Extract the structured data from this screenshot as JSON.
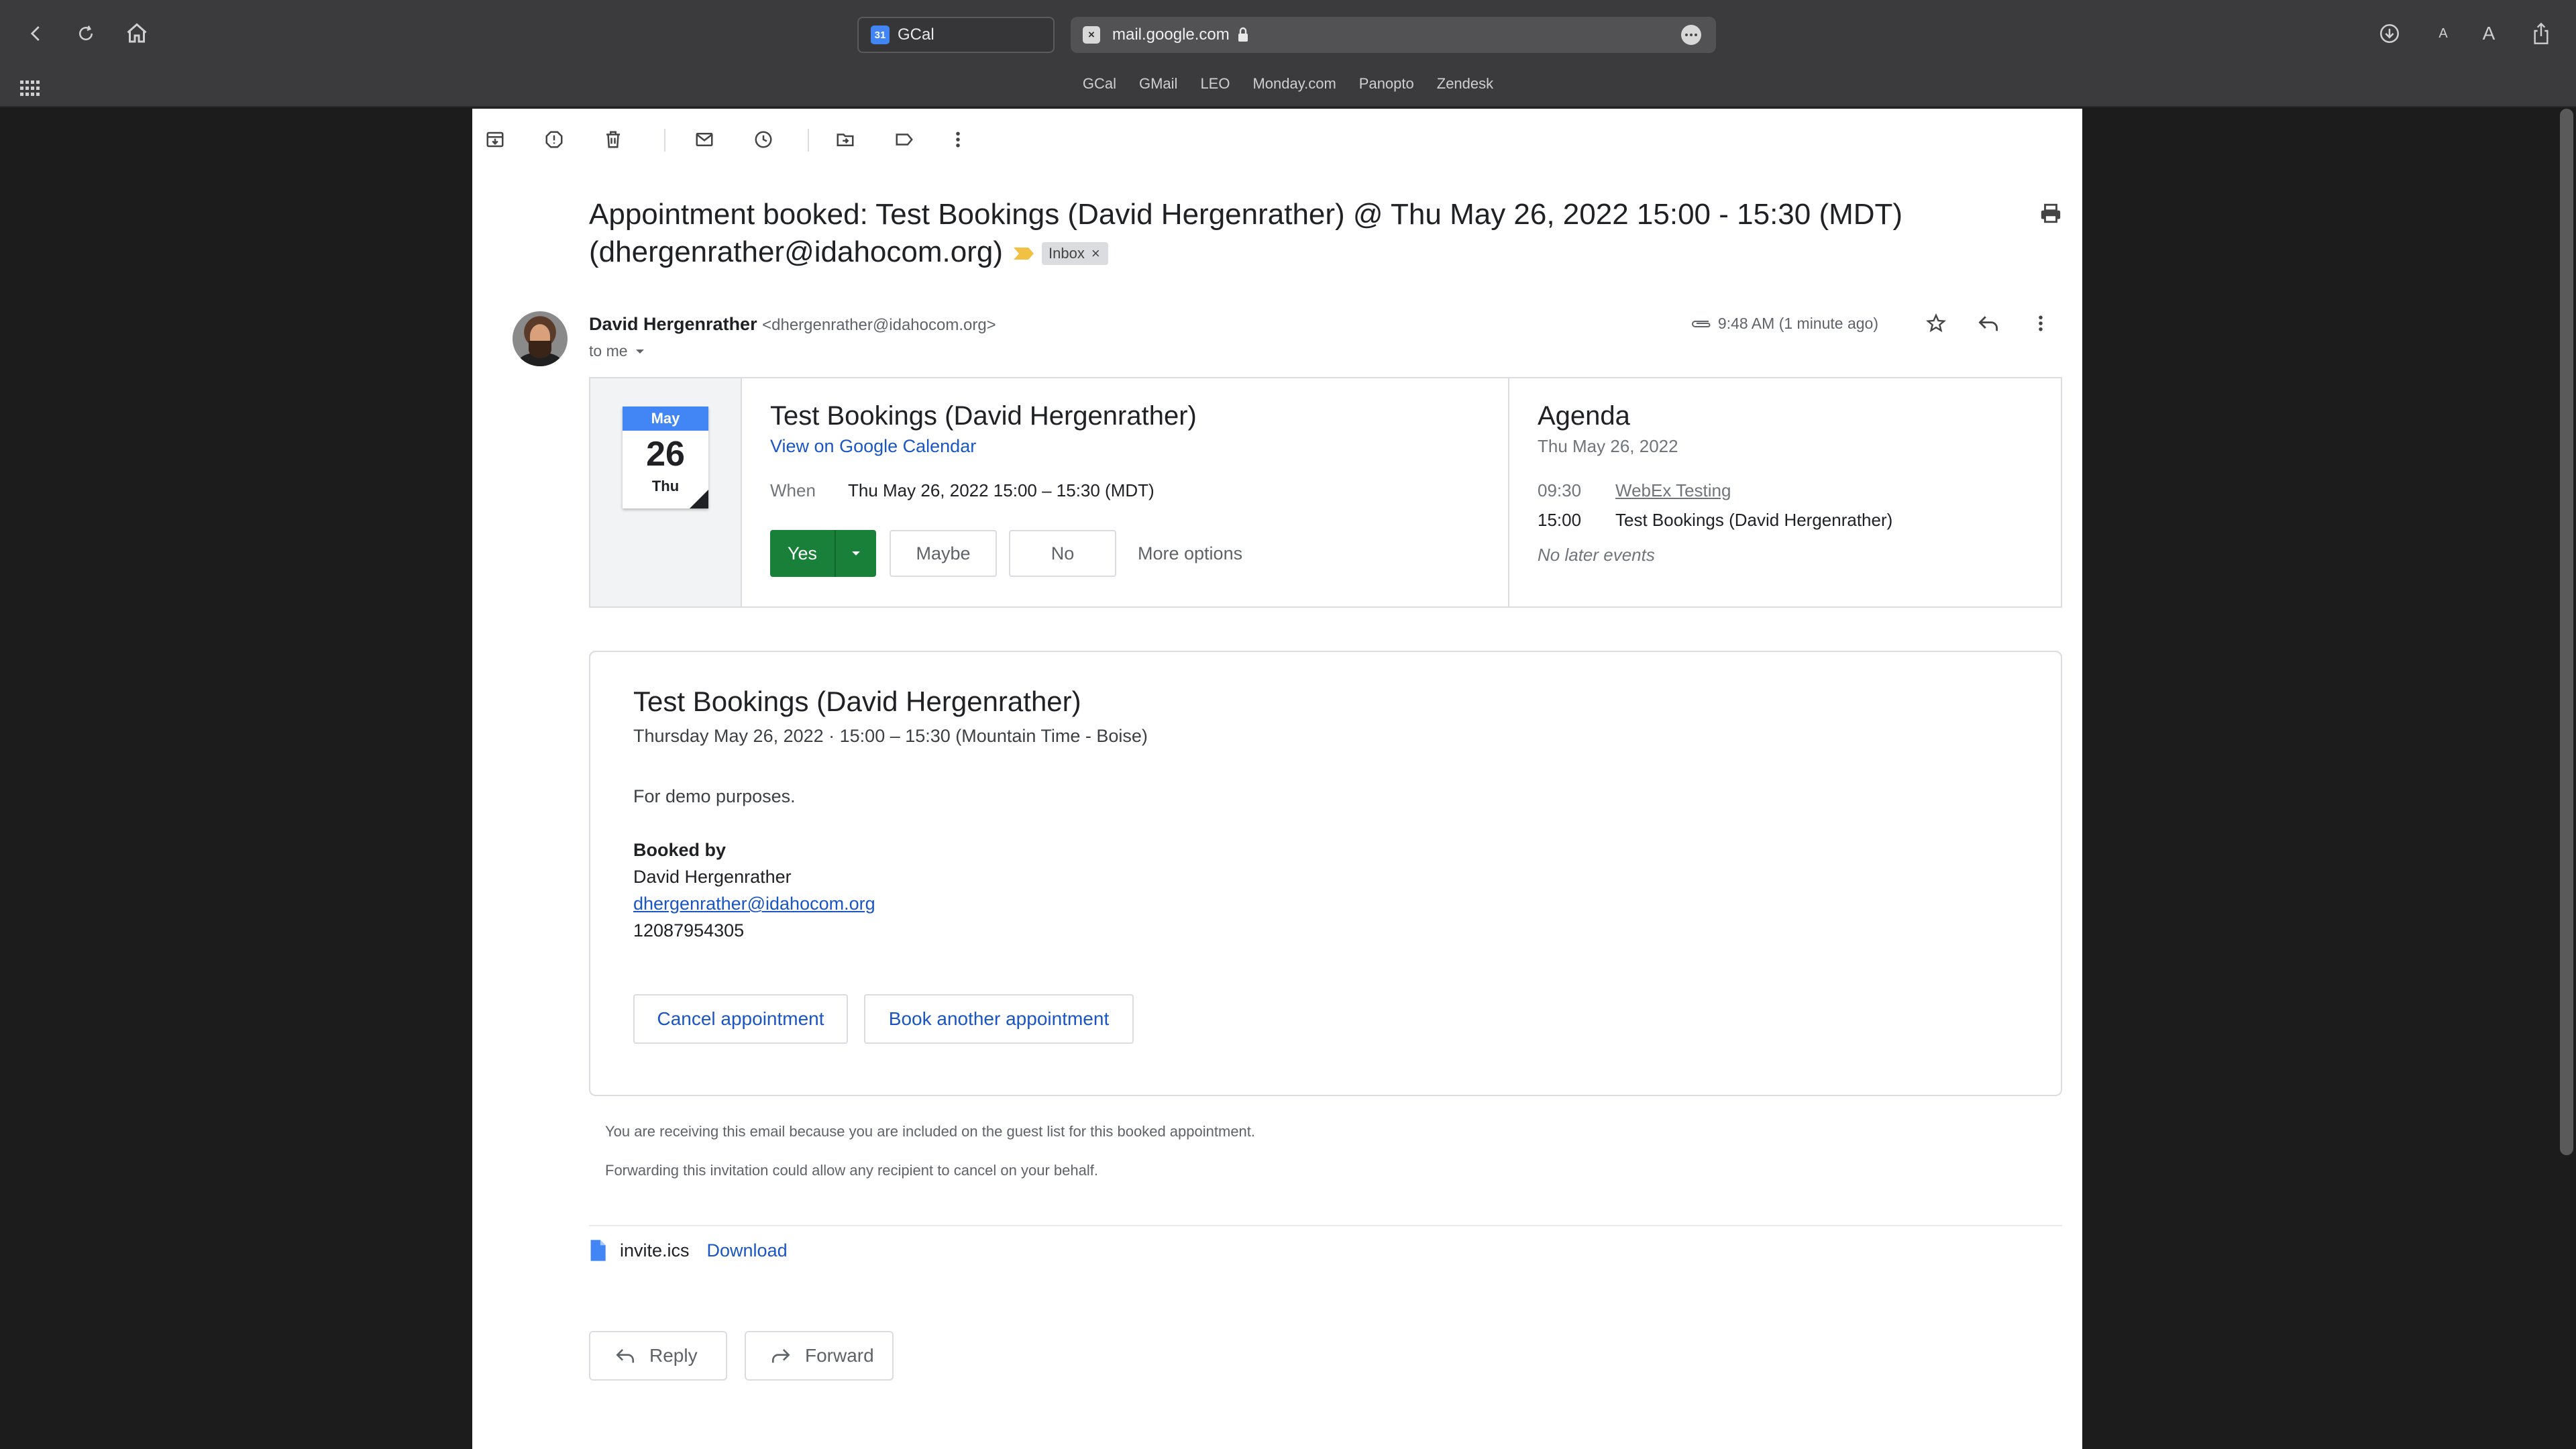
{
  "browser": {
    "tab": {
      "title": "GCal",
      "favicon_text": "31"
    },
    "address": {
      "url": "mail.google.com",
      "favicon_text": "×"
    },
    "bookmarks": [
      "GCal",
      "GMail",
      "LEO",
      "Monday.com",
      "Panopto",
      "Zendesk"
    ],
    "text_small": "A",
    "text_large": "A"
  },
  "email": {
    "subject": "Appointment booked: Test Bookings (David Hergenrather) @ Thu May 26, 2022 15:00 - 15:30 (MDT) (dhergenrather@idahocom.org)",
    "label_chip": "Inbox",
    "label_chip_remove": "×",
    "sender_name": "David Hergenrather",
    "sender_email": "<dhergenrather@idahocom.org>",
    "to": "to me",
    "time": "9:48 AM (1 minute ago)"
  },
  "invite": {
    "cal_month": "May",
    "cal_day": "26",
    "cal_dow": "Thu",
    "title": "Test Bookings (David Hergenrather)",
    "view_link": "View on Google Calendar",
    "when_label": "When",
    "when_value": "Thu May 26, 2022 15:00 – 15:30 (MDT)",
    "yes": "Yes",
    "maybe": "Maybe",
    "no": "No",
    "more_options": "More options"
  },
  "agenda": {
    "title": "Agenda",
    "date": "Thu May 26, 2022",
    "events": [
      {
        "time": "09:30",
        "title": "WebEx Testing"
      },
      {
        "time": "15:00",
        "title": "Test Bookings (David Hergenrather)"
      }
    ],
    "no_later": "No later events"
  },
  "booking": {
    "title": "Test Bookings (David Hergenrather)",
    "date_line": "Thursday May 26, 2022 · 15:00 – 15:30 (Mountain Time - Boise)",
    "description": "For demo purposes.",
    "booked_by_label": "Booked by",
    "booked_by_name": "David Hergenrather",
    "booked_by_email": "dhergenrather@idahocom.org",
    "booked_by_phone": "12087954305",
    "cancel_button": "Cancel appointment",
    "book_another_button": "Book another appointment"
  },
  "footer": {
    "notice1": "You are receiving this email because you are included on the guest list for this booked appointment.",
    "notice2": "Forwarding this invitation could allow any recipient to cancel on your behalf."
  },
  "attachment": {
    "name": "invite.ics",
    "download": "Download"
  },
  "actions": {
    "reply": "Reply",
    "forward": "Forward"
  },
  "colors": {
    "accent_blue": "#1a55c6",
    "yes_green": "#188038",
    "calendar_blue": "#4285f4",
    "important_marker": "#f2c043"
  }
}
